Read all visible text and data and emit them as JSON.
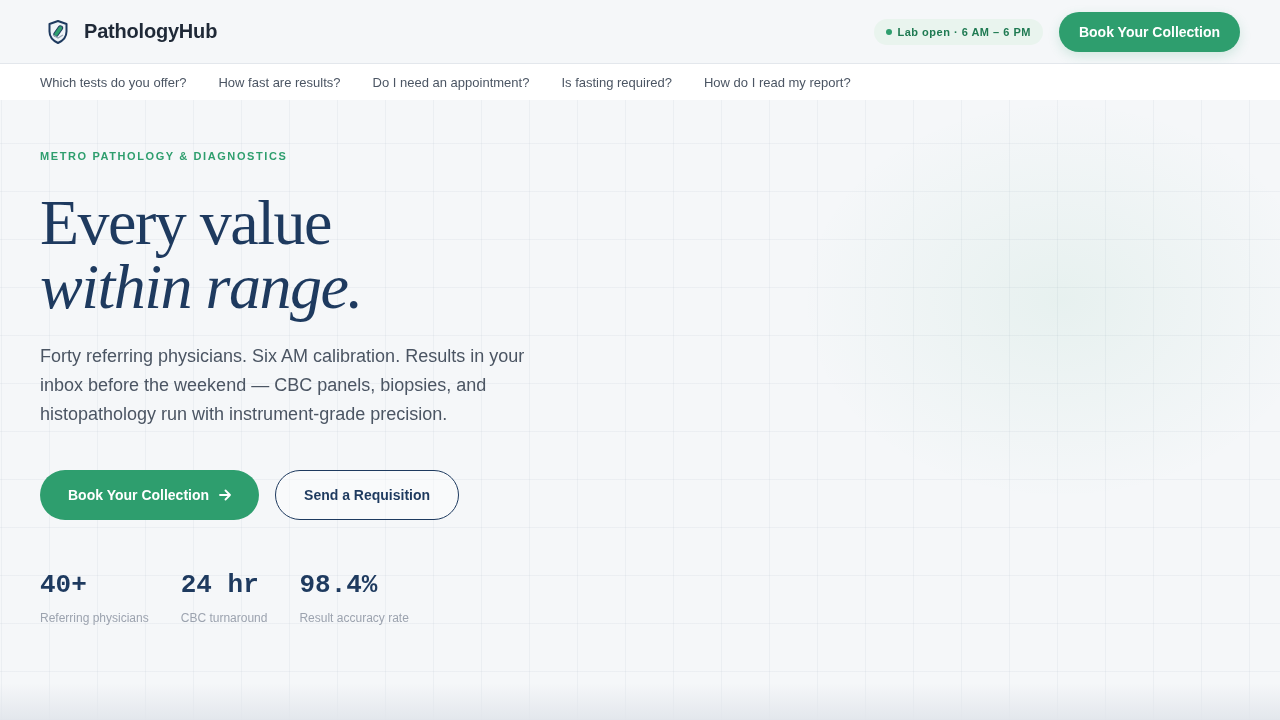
{
  "header": {
    "brand": "PathologyHub",
    "status_badge": "Lab open · 6 AM – 6 PM",
    "cta": "Book Your Collection"
  },
  "faq_nav": [
    "Which tests do you offer?",
    "How fast are results?",
    "Do I need an appointment?",
    "Is fasting required?",
    "How do I read my report?"
  ],
  "hero": {
    "eyebrow": "METRO PATHOLOGY & DIAGNOSTICS",
    "headline": "Every value\n*within range.*",
    "body": "Forty referring physicians. Six AM calibration. Results in your inbox before the weekend — CBC panels, biopsies, and histopathology run with instrument-grade precision.",
    "buttons": [
      {
        "label": "Book Your Collection",
        "kind": "primary"
      },
      {
        "label": "Send a Requisition",
        "kind": "secondary"
      }
    ],
    "stats": [
      {
        "value": "40+",
        "label": "Referring physicians"
      },
      {
        "value": "24 hr",
        "label": "CBC turnaround"
      },
      {
        "value": "98.4%",
        "label": "Result accuracy rate"
      }
    ]
  }
}
